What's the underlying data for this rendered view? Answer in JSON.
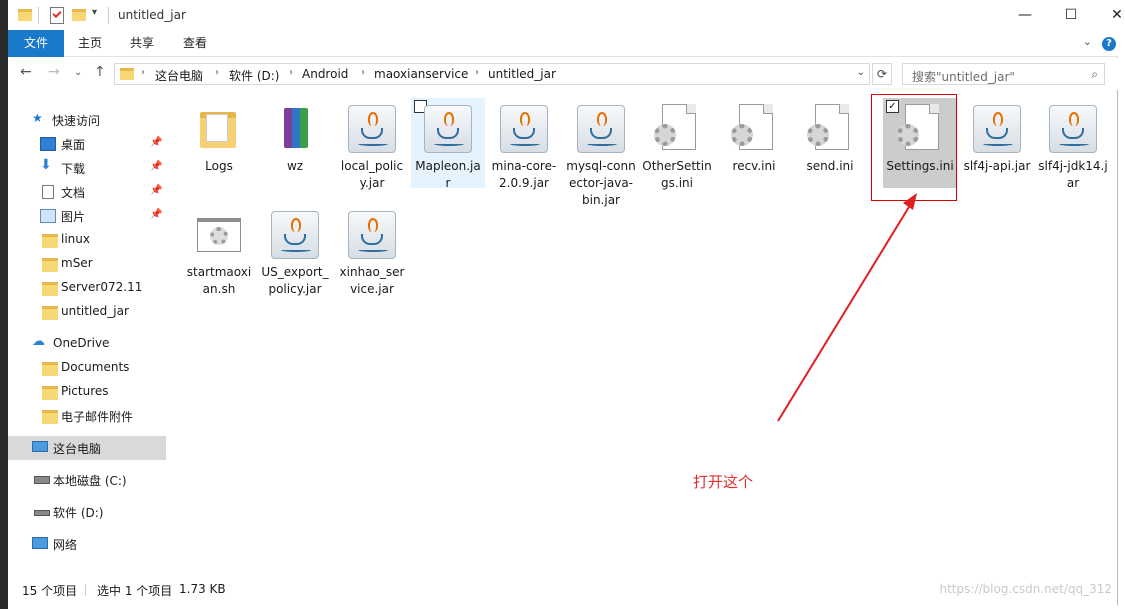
{
  "window": {
    "title": "untitled_jar",
    "buttons": {
      "minimize": "—",
      "maximize": "☐",
      "close": "✕"
    }
  },
  "ribbon": {
    "tabs": [
      {
        "label": "文件",
        "active": true
      },
      {
        "label": "主页"
      },
      {
        "label": "共享"
      },
      {
        "label": "查看"
      }
    ],
    "help": "?"
  },
  "address": {
    "breadcrumbs": [
      "这台电脑",
      "软件 (D:)",
      "Android",
      "maoxianservice",
      "untitled_jar"
    ],
    "search_placeholder": "搜索\"untitled_jar\""
  },
  "nav_pane": {
    "quick_access": "快速访问",
    "items": [
      {
        "label": "桌面",
        "icon": "desktop-icon",
        "pinned": true
      },
      {
        "label": "下载",
        "icon": "download-icon",
        "pinned": true
      },
      {
        "label": "文档",
        "icon": "documents-icon",
        "pinned": true
      },
      {
        "label": "图片",
        "icon": "pictures-icon",
        "pinned": true
      },
      {
        "label": "linux",
        "icon": "folder-icon"
      },
      {
        "label": "mSer",
        "icon": "folder-icon"
      },
      {
        "label": "Server072.11",
        "icon": "folder-icon"
      },
      {
        "label": "untitled_jar",
        "icon": "folder-icon"
      }
    ],
    "onedrive": "OneDrive",
    "onedrive_items": [
      "Documents",
      "Pictures",
      "电子邮件附件"
    ],
    "this_pc": "这台电脑",
    "drives": [
      "本地磁盘 (C:)",
      "软件 (D:)"
    ],
    "network": "网络"
  },
  "files": [
    {
      "name": "Logs",
      "type": "folder"
    },
    {
      "name": "wz",
      "type": "winrar"
    },
    {
      "name": "local_policy.jar",
      "type": "jar"
    },
    {
      "name": "Mapleon.jar",
      "type": "jar",
      "state": "hover"
    },
    {
      "name": "mina-core-2.0.9.jar",
      "type": "jar"
    },
    {
      "name": "mysql-connector-java-bin.jar",
      "type": "jar"
    },
    {
      "name": "OtherSettings.ini",
      "type": "ini"
    },
    {
      "name": "recv.ini",
      "type": "ini"
    },
    {
      "name": "send.ini",
      "type": "ini"
    },
    {
      "name": "Settings.ini",
      "type": "ini",
      "state": "selected"
    },
    {
      "name": "slf4j-api.jar",
      "type": "jar"
    },
    {
      "name": "slf4j-jdk14.jar",
      "type": "jar"
    },
    {
      "name": "startmaoxian.sh",
      "type": "sh"
    },
    {
      "name": "US_export_policy.jar",
      "type": "jar"
    },
    {
      "name": "xinhao_service.jar",
      "type": "jar"
    }
  ],
  "annotation": {
    "text": "打开这个",
    "color": "#e03030"
  },
  "status": {
    "count": "15 个项目",
    "selection": "选中 1 个项目",
    "size": "1.73 KB",
    "watermark": "https://blog.csdn.net/qq_312"
  },
  "colors": {
    "accent": "#1979ca",
    "annotation": "#e00000",
    "selected": "#cccccc",
    "hover": "#e5f3ff"
  }
}
